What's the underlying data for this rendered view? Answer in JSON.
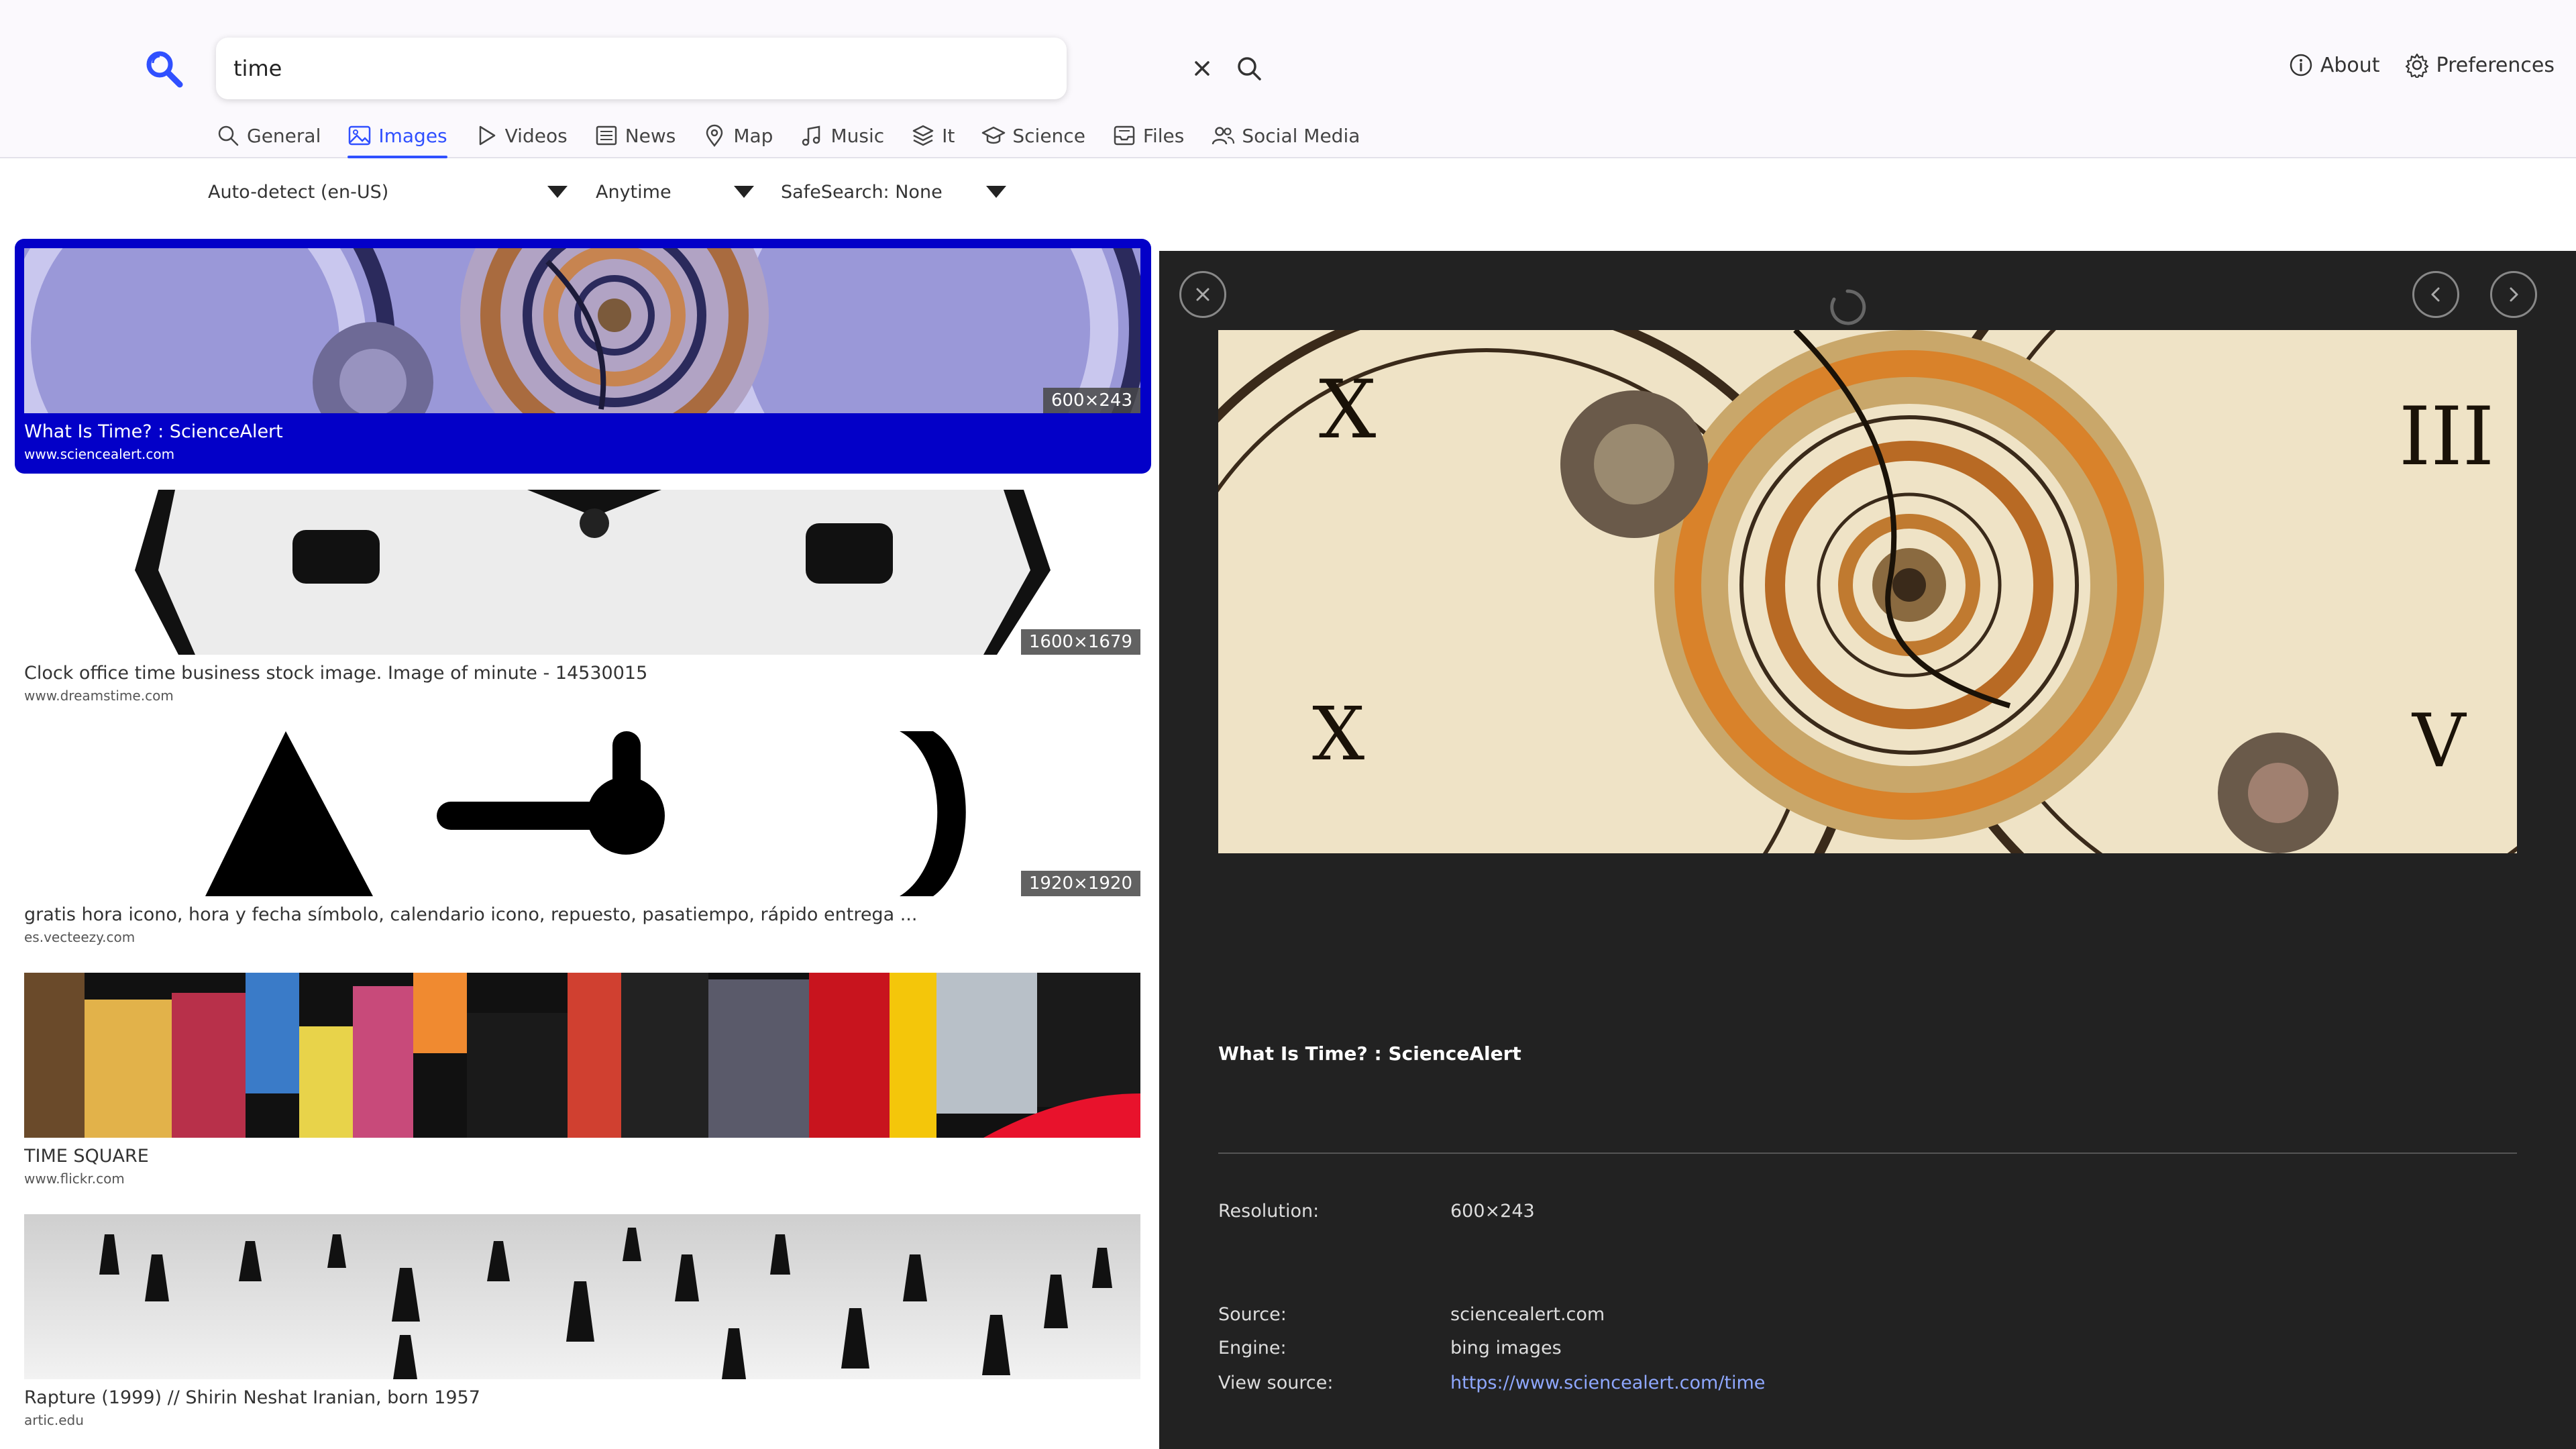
{
  "search": {
    "query": "time"
  },
  "top_links": {
    "about": "About",
    "preferences": "Preferences"
  },
  "tabs": [
    "General",
    "Images",
    "Videos",
    "News",
    "Map",
    "Music",
    "It",
    "Science",
    "Files",
    "Social Media"
  ],
  "active_tab": "Images",
  "filters": {
    "language": "Auto-detect (en-US)",
    "time": "Anytime",
    "safesearch": "SafeSearch: None"
  },
  "results": [
    {
      "title": "What Is Time? : ScienceAlert",
      "url": "www.sciencealert.com",
      "resolution": "600×243",
      "selected": true
    },
    {
      "title": "Clock office time business stock image. Image of minute - 14530015",
      "url": "www.dreamstime.com",
      "resolution": "1600×1679"
    },
    {
      "title": "gratis hora icono, hora y fecha símbolo, calendario icono, repuesto, pasatiempo, rápido entrega ...",
      "url": "es.vecteezy.com",
      "resolution": "1920×1920"
    },
    {
      "title": "TIME SQUARE",
      "url": "www.flickr.com",
      "resolution": ""
    },
    {
      "title": "Rapture (1999) // Shirin Neshat Iranian, born 1957",
      "url": "artic.edu",
      "resolution": ""
    }
  ],
  "detail": {
    "title": "What Is Time? : ScienceAlert",
    "resolution_label": "Resolution:",
    "resolution": "600×243",
    "source_label": "Source:",
    "source": "sciencealert.com",
    "engine_label": "Engine:",
    "engine": "bing images",
    "view_source_label": "View source:",
    "view_source": "https://www.sciencealert.com/time"
  },
  "colors": {
    "accent": "#3050ff",
    "selected_bg": "#0300c8",
    "panel_bg": "#222222",
    "link": "#8fa8ff"
  }
}
